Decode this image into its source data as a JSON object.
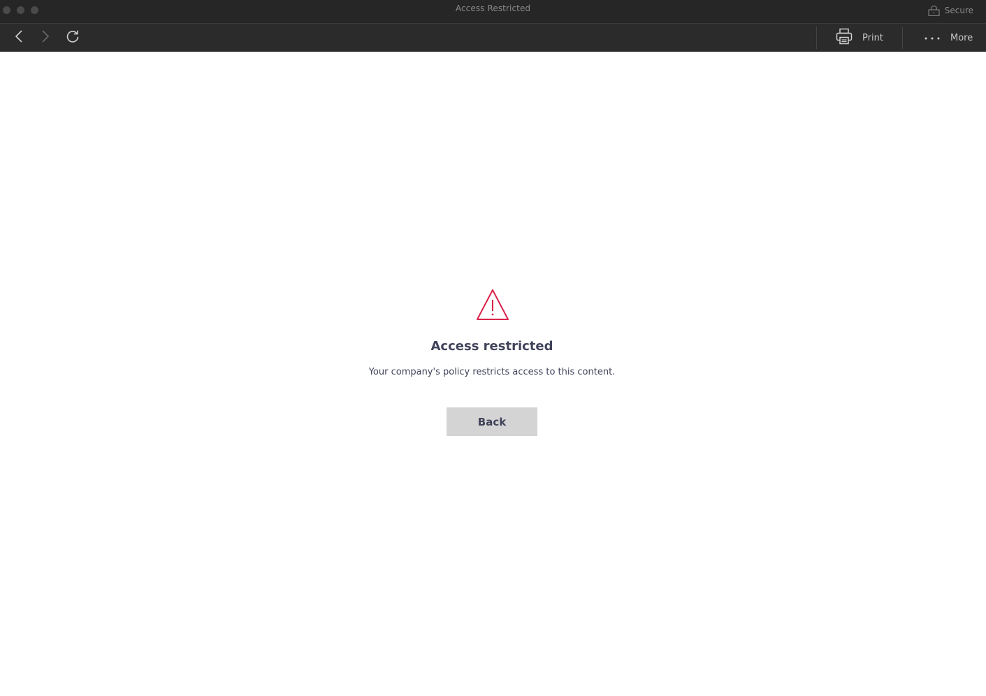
{
  "window": {
    "title": "Access Restricted",
    "secure_label": "Secure"
  },
  "toolbar": {
    "print_label": "Print",
    "more_label": "More",
    "back_icon": "chevron-left-icon",
    "forward_icon": "chevron-right-icon",
    "reload_icon": "reload-icon",
    "print_icon": "printer-icon",
    "more_icon": "ellipsis-icon"
  },
  "main": {
    "icon": "warning-triangle-icon",
    "heading": "Access restricted",
    "message": "Your company's policy restricts access to this content.",
    "back_button_label": "Back"
  },
  "colors": {
    "accent_warning": "#d9234a",
    "titlebar_bg": "#262626",
    "toolbar_bg": "#2b2b2b",
    "text": "#40435a",
    "button_bg": "#d4d4d4"
  }
}
